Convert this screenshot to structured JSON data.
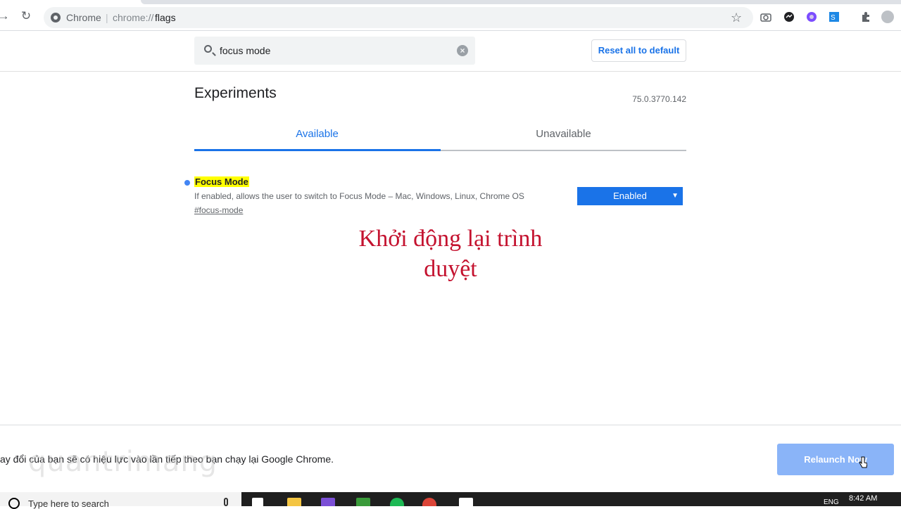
{
  "browser": {
    "site_name": "Chrome",
    "separator": "|",
    "url_scheme": "chrome://",
    "url_path": "flags",
    "icons": [
      "back-arrow-icon",
      "reload-icon",
      "bookmark-star-icon",
      "camera-icon",
      "messenger-icon",
      "extension-icon",
      "extension-icon",
      "puzzle-icon",
      "profile-icon"
    ]
  },
  "flags_header": {
    "search_value": "focus mode",
    "reset_label": "Reset all to default"
  },
  "main": {
    "title": "Experiments",
    "version": "75.0.3770.142",
    "tabs": [
      {
        "label": "Available",
        "active": true
      },
      {
        "label": "Unavailable",
        "active": false
      }
    ]
  },
  "experiment": {
    "name": "Focus Mode",
    "description": "If enabled, allows the user to switch to Focus Mode – Mac, Windows, Linux, Chrome OS",
    "link": "#focus-mode",
    "selected": "Enabled"
  },
  "caption": {
    "line1": "Khởi động lại trình",
    "line2": "duyệt"
  },
  "relaunch": {
    "message": "ay đổi của bạn sẽ có hiệu lực vào lần tiếp theo bạn chạy lại Google Chrome.",
    "button": "Relaunch Now"
  },
  "watermark": "quantrimang",
  "taskbar": {
    "search_placeholder": "Type here to search",
    "language": "ENG",
    "time": "8:42 AM"
  },
  "colors": {
    "accent": "#1a73e8",
    "highlight": "#ffff00",
    "caption": "#c4122f",
    "relaunch_button": "#8ab4f8"
  }
}
